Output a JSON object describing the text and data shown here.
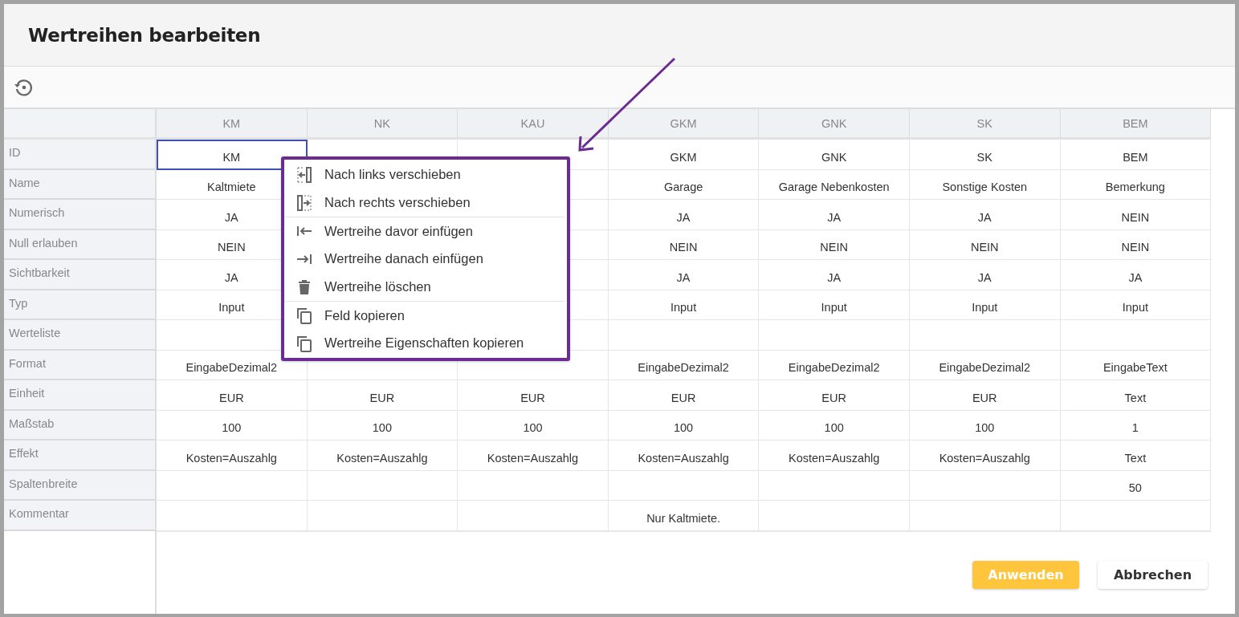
{
  "dialog": {
    "title": "Wertreihen bearbeiten"
  },
  "table": {
    "row_labels": [
      "ID",
      "Name",
      "Numerisch",
      "Null erlauben",
      "Sichtbarkeit",
      "Typ",
      "Werteliste",
      "Format",
      "Einheit",
      "Maßstab",
      "Effekt",
      "Spaltenbreite",
      "Kommentar"
    ],
    "columns": [
      {
        "header": "KM",
        "cells": [
          {
            "text": "KM",
            "selected": true
          },
          {
            "text": "Kaltmiete",
            "selected": false
          },
          {
            "text": "JA",
            "selected": false
          },
          {
            "text": "NEIN",
            "selected": false
          },
          {
            "text": "JA",
            "selected": false
          },
          {
            "text": "Input",
            "selected": false
          },
          {
            "selected": false
          },
          {
            "text": "EingabeDezimal2",
            "selected": false
          },
          {
            "text": "EUR",
            "selected": false
          },
          {
            "text": "100",
            "selected": false
          },
          {
            "text": "Kosten=Auszahlg",
            "selected": false
          },
          {
            "selected": false
          },
          {
            "selected": false
          }
        ]
      },
      {
        "header": "NK",
        "cells": [
          {
            "selected": false
          },
          null,
          null,
          null,
          null,
          null,
          null,
          {
            "selected": false
          },
          {
            "text": "EUR",
            "selected": false
          },
          {
            "text": "100",
            "selected": false
          },
          {
            "text": "Kosten=Auszahlg",
            "selected": false
          },
          {
            "selected": false
          },
          {
            "selected": false
          }
        ]
      },
      {
        "header": "KAU",
        "cells": [
          {
            "selected": false
          },
          {
            "selected": false
          },
          {
            "selected": false
          },
          {
            "selected": false
          },
          {
            "selected": false
          },
          {
            "selected": false
          },
          {
            "selected": false
          },
          {
            "selected": false
          },
          {
            "text": "EUR",
            "selected": false
          },
          {
            "text": "100",
            "selected": false
          },
          {
            "text": "Kosten=Auszahlg",
            "selected": false
          },
          {
            "selected": false
          },
          {
            "selected": false
          }
        ]
      },
      {
        "header": "GKM",
        "cells": [
          {
            "text": "GKM",
            "selected": false
          },
          {
            "text": "Garage",
            "selected": false
          },
          {
            "text": "JA",
            "selected": false
          },
          {
            "text": "NEIN",
            "selected": false
          },
          {
            "text": "JA",
            "selected": false
          },
          {
            "text": "Input",
            "selected": false
          },
          {
            "selected": false
          },
          {
            "text": "EingabeDezimal2",
            "selected": false
          },
          {
            "text": "EUR",
            "selected": false
          },
          {
            "text": "100",
            "selected": false
          },
          {
            "text": "Kosten=Auszahlg",
            "selected": false
          },
          {
            "selected": false
          },
          {
            "text": "Nur Kaltmiete.",
            "selected": false
          }
        ]
      },
      {
        "header": "GNK",
        "cells": [
          {
            "text": "GNK",
            "selected": false
          },
          {
            "text": "Garage Nebenkosten",
            "selected": false
          },
          {
            "text": "JA",
            "selected": false
          },
          {
            "text": "NEIN",
            "selected": false
          },
          {
            "text": "JA",
            "selected": false
          },
          {
            "text": "Input",
            "selected": false
          },
          {
            "selected": false
          },
          {
            "text": "EingabeDezimal2",
            "selected": false
          },
          {
            "text": "EUR",
            "selected": false
          },
          {
            "text": "100",
            "selected": false
          },
          {
            "text": "Kosten=Auszahlg",
            "selected": false
          },
          {
            "selected": false
          },
          {
            "selected": false
          }
        ]
      },
      {
        "header": "SK",
        "cells": [
          {
            "text": "SK",
            "selected": false
          },
          {
            "text": "Sonstige Kosten",
            "selected": false
          },
          {
            "text": "JA",
            "selected": false
          },
          {
            "text": "NEIN",
            "selected": false
          },
          {
            "text": "JA",
            "selected": false
          },
          {
            "text": "Input",
            "selected": false
          },
          {
            "selected": false
          },
          {
            "text": "EingabeDezimal2",
            "selected": false
          },
          {
            "text": "EUR",
            "selected": false
          },
          {
            "text": "100",
            "selected": false
          },
          {
            "text": "Kosten=Auszahlg",
            "selected": false
          },
          {
            "selected": false
          },
          {
            "selected": false
          }
        ]
      },
      {
        "header": "BEM",
        "cells": [
          {
            "text": "BEM",
            "selected": false
          },
          {
            "text": "Bemerkung",
            "selected": false
          },
          {
            "text": "NEIN",
            "selected": false
          },
          {
            "text": "NEIN",
            "selected": false
          },
          {
            "text": "JA",
            "selected": false
          },
          {
            "text": "Input",
            "selected": false
          },
          {
            "selected": false
          },
          {
            "text": "EingabeText",
            "selected": false
          },
          {
            "text": "Text",
            "selected": false
          },
          {
            "text": "1",
            "selected": false
          },
          {
            "text": "Text",
            "selected": false
          },
          {
            "text": "50",
            "selected": false
          },
          {
            "selected": false
          }
        ]
      }
    ]
  },
  "context_menu": {
    "items": [
      {
        "kind": "move-left",
        "label": "Nach links verschieben",
        "divider_before": false
      },
      {
        "kind": "move-right",
        "label": "Nach rechts verschieben",
        "divider_before": false
      },
      {
        "kind": "insert-before",
        "label": "Wertreihe davor einfügen",
        "divider_before": true
      },
      {
        "kind": "insert-after",
        "label": "Wertreihe danach einfügen",
        "divider_before": false
      },
      {
        "kind": "delete",
        "label": "Wertreihe löschen",
        "divider_before": false
      },
      {
        "kind": "copy",
        "label": "Feld kopieren",
        "divider_before": true
      },
      {
        "kind": "copy",
        "label": "Wertreihe Eigenschaften kopieren",
        "divider_before": false
      }
    ]
  },
  "buttons": [
    {
      "kind": "primary",
      "label": "Anwenden"
    },
    {
      "kind": "secondary",
      "label": "Abbrechen"
    }
  ]
}
